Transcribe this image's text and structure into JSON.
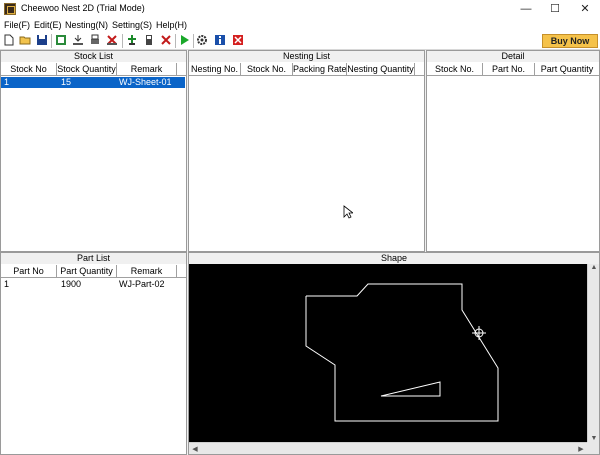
{
  "window": {
    "title": "Cheewoo Nest 2D (Trial Mode)",
    "minimize_glyph": "—",
    "maximize_glyph": "☐",
    "close_glyph": "✕"
  },
  "menu": [
    "File(F)",
    "Edit(E)",
    "Nesting(N)",
    "Setting(S)",
    "Help(H)"
  ],
  "toolbar": {
    "icons": [
      "new-file-icon",
      "open-folder-icon",
      "save-icon",
      "export-icon",
      "import-stock-icon",
      "print-icon",
      "delete-stock-icon",
      "add-part-icon",
      "part-icon",
      "delete-part-icon",
      "run-icon",
      "settings-icon",
      "info-icon",
      "close-icon"
    ],
    "buy_now_label": "Buy Now"
  },
  "stock_list": {
    "title": "Stock List",
    "columns": [
      "Stock No",
      "Stock Quantity",
      "Remark"
    ],
    "rows": [
      [
        "1",
        "15",
        "WJ-Sheet-01"
      ]
    ]
  },
  "nesting_list": {
    "title": "Nesting List",
    "columns": [
      "Nesting No.",
      "Stock No.",
      "Packing Rate",
      "Nesting Quantity"
    ]
  },
  "detail": {
    "title": "Detail",
    "columns": [
      "Stock No.",
      "Part No.",
      "Part Quantity"
    ]
  },
  "part_list": {
    "title": "Part List",
    "columns": [
      "Part No",
      "Part Quantity",
      "Remark"
    ],
    "rows": [
      [
        "1",
        "1900",
        "WJ-Part-02"
      ]
    ]
  },
  "shape": {
    "title": "Shape"
  },
  "colors": {
    "selection": "#0a64c8",
    "buy_now": "#f5c24a",
    "shape_background": "#000000",
    "shape_line": "#ffffff"
  }
}
